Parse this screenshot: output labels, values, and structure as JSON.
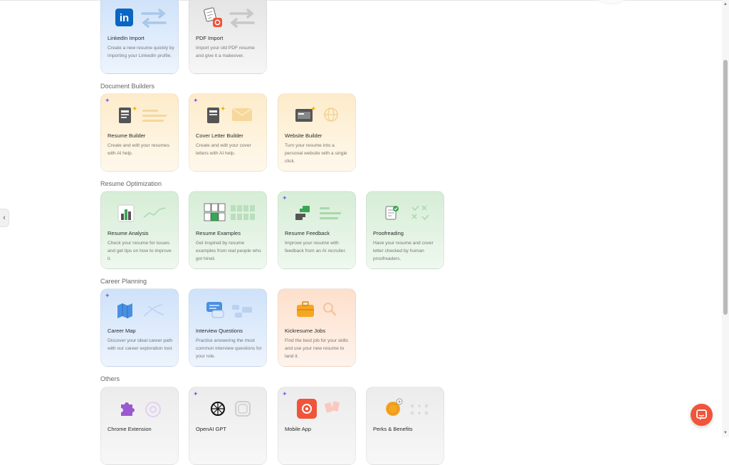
{
  "sections": {
    "document_builders": "Document Builders",
    "resume_optimization": "Resume Optimization",
    "career_planning": "Career Planning",
    "others": "Others"
  },
  "cards": {
    "linkedin_import": {
      "title": "LinkedIn Import",
      "desc": "Create a new resume quickly by importing your LinkedIn profile."
    },
    "pdf_import": {
      "title": "PDF Import",
      "desc": "Import your old PDF resume and give it a makeover."
    },
    "resume_builder": {
      "title": "Resume Builder",
      "desc": "Create and edit your resumes with AI help."
    },
    "cover_letter_builder": {
      "title": "Cover Letter Builder",
      "desc": "Create and edit your cover letters with AI help."
    },
    "website_builder": {
      "title": "Website Builder",
      "desc": "Turn your resume into a personal website with a single click."
    },
    "resume_analysis": {
      "title": "Resume Analysis",
      "desc": "Check your resume for issues and get tips on how to improve it."
    },
    "resume_examples": {
      "title": "Resume Examples",
      "desc": "Get inspired by resume examples from real people who got hired."
    },
    "resume_feedback": {
      "title": "Resume Feedback",
      "desc": "Improve your resume with feedback from an AI recruiter."
    },
    "proofreading": {
      "title": "Proofreading",
      "desc": "Have your resume and cover letter checked by human proofreaders."
    },
    "career_map": {
      "title": "Career Map",
      "desc": "Discover your ideal career path with our career exploration tool."
    },
    "interview_questions": {
      "title": "Interview Questions",
      "desc": "Practice answering the most common interview questions for your role."
    },
    "kickresume_jobs": {
      "title": "Kickresume Jobs",
      "desc": "Find the best job for your skills and use your new resume to land it."
    },
    "chrome_extension": {
      "title": "Chrome Extension"
    },
    "openai_gpt": {
      "title": "OpenAI GPT"
    },
    "mobile_app": {
      "title": "Mobile App"
    },
    "perks_benefits": {
      "title": "Perks & Benefits"
    }
  },
  "icons": {
    "linkedin_logo": "in",
    "sparkle": "✦",
    "left_toggle": "‹",
    "scroll_up": "▲",
    "scroll_down": "▼"
  },
  "colors": {
    "accent": "#f0543a",
    "linkedin_blue": "#0a66c2",
    "sparkle_purple": "#8b5cf6"
  }
}
